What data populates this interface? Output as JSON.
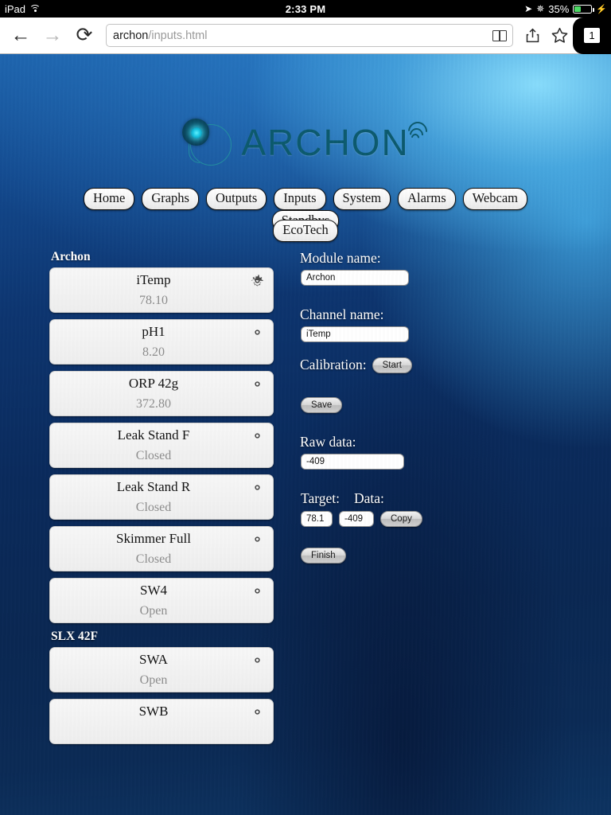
{
  "status_bar": {
    "carrier": "iPad",
    "wifi_icon": "wifi-icon",
    "time": "2:33 PM",
    "location_icon": "location-arrow-icon",
    "bluetooth_icon": "bluetooth-icon",
    "battery_percent": "35%",
    "battery_icon": "battery-icon",
    "charging_icon": "lightning-bolt-icon"
  },
  "browser": {
    "back_icon": "back-arrow-icon",
    "forward_icon": "forward-arrow-icon",
    "reload_icon": "reload-icon",
    "url_host": "archon",
    "url_path": "/inputs.html",
    "reader_icon": "reader-view-icon",
    "share_icon": "share-icon",
    "bookmark_icon": "bookmark-star-icon",
    "tab_count": "1"
  },
  "site": {
    "logo_text": "ARCHON",
    "logo_mark": "archon-logo-mark",
    "logo_signal": "wifi-signal-icon"
  },
  "nav": {
    "row1": [
      "Home",
      "Graphs",
      "Outputs",
      "Inputs",
      "System",
      "Alarms",
      "Webcam",
      "Standbys"
    ],
    "row2": [
      "EcoTech"
    ]
  },
  "groups": [
    {
      "title": "Archon",
      "items": [
        {
          "name": "iTemp",
          "value": "78.10",
          "align": "center"
        },
        {
          "name": "pH1",
          "value": "8.20",
          "align": "center"
        },
        {
          "name": "ORP 42g",
          "value": "372.80",
          "align": "center"
        },
        {
          "name": "Leak Stand F",
          "value": "Closed",
          "align": "center"
        },
        {
          "name": "Leak Stand R",
          "value": "Closed",
          "align": "center"
        },
        {
          "name": "Skimmer Full",
          "value": "Closed",
          "align": "center"
        },
        {
          "name": "SW4",
          "value": "Open",
          "align": "center"
        }
      ]
    },
    {
      "title": "SLX 42F",
      "items": [
        {
          "name": "SWA",
          "value": "Open",
          "align": "center"
        },
        {
          "name": "SWB",
          "value": "",
          "align": "center"
        }
      ]
    }
  ],
  "form": {
    "module_label": "Module name:",
    "module_value": "Archon",
    "channel_label": "Channel name:",
    "channel_value": "iTemp",
    "calibration_label": "Calibration:",
    "start_button": "Start",
    "save_button": "Save",
    "raw_label": "Raw data:",
    "raw_value": "-409",
    "target_label": "Target:",
    "data_label": "Data:",
    "target_value": "78.1",
    "data_value": "-409",
    "copy_button": "Copy",
    "finish_button": "Finish"
  },
  "colors": {
    "accent": "#0c5a6e",
    "ocean_deep": "#0a2752",
    "ocean_light": "#8ce1ff",
    "battery_green": "#4cd964"
  }
}
